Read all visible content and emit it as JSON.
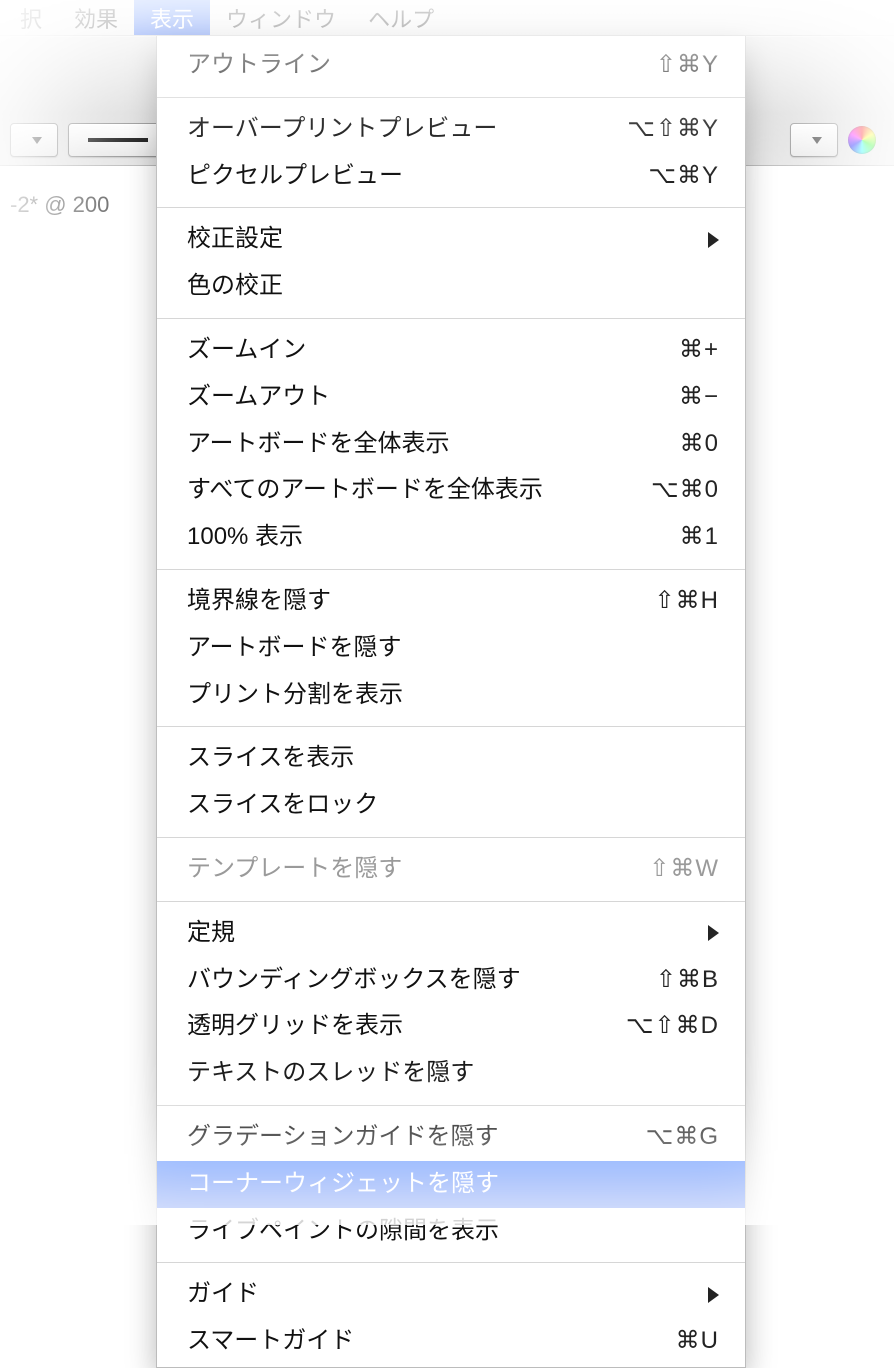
{
  "menubar": {
    "items": [
      {
        "label": "択"
      },
      {
        "label": "効果"
      },
      {
        "label": "表示",
        "active": true
      },
      {
        "label": "ウィンドウ"
      },
      {
        "label": "ヘルプ"
      }
    ]
  },
  "doc_tab": "-2* @ 200",
  "menu": {
    "groups": [
      [
        {
          "id": "outline",
          "label": "アウトライン",
          "shortcut": "⇧⌘Y"
        }
      ],
      [
        {
          "id": "overprint-preview",
          "label": "オーバープリントプレビュー",
          "shortcut": "⌥⇧⌘Y"
        },
        {
          "id": "pixel-preview",
          "label": "ピクセルプレビュー",
          "shortcut": "⌥⌘Y"
        }
      ],
      [
        {
          "id": "proof-setup",
          "label": "校正設定",
          "submenu": true
        },
        {
          "id": "proof-colors",
          "label": "色の校正"
        }
      ],
      [
        {
          "id": "zoom-in",
          "label": "ズームイン",
          "shortcut": "⌘+"
        },
        {
          "id": "zoom-out",
          "label": "ズームアウト",
          "shortcut": "⌘−"
        },
        {
          "id": "fit-artboard",
          "label": "アートボードを全体表示",
          "shortcut": "⌘0"
        },
        {
          "id": "fit-all-artboards",
          "label": "すべてのアートボードを全体表示",
          "shortcut": "⌥⌘0"
        },
        {
          "id": "actual-size",
          "label": "100% 表示",
          "shortcut": "⌘1"
        }
      ],
      [
        {
          "id": "hide-edges",
          "label": "境界線を隠す",
          "shortcut": "⇧⌘H"
        },
        {
          "id": "hide-artboards",
          "label": "アートボードを隠す"
        },
        {
          "id": "show-print-tiling",
          "label": "プリント分割を表示"
        }
      ],
      [
        {
          "id": "show-slices",
          "label": "スライスを表示"
        },
        {
          "id": "lock-slices",
          "label": "スライスをロック"
        }
      ],
      [
        {
          "id": "hide-template",
          "label": "テンプレートを隠す",
          "shortcut": "⇧⌘W",
          "disabled": true
        }
      ],
      [
        {
          "id": "rulers",
          "label": "定規",
          "submenu": true
        },
        {
          "id": "hide-bounding-box",
          "label": "バウンディングボックスを隠す",
          "shortcut": "⇧⌘B"
        },
        {
          "id": "show-transparency-grid",
          "label": "透明グリッドを表示",
          "shortcut": "⌥⇧⌘D"
        },
        {
          "id": "hide-text-threads",
          "label": "テキストのスレッドを隠す"
        }
      ],
      [
        {
          "id": "hide-gradient-annotator",
          "label": "グラデーションガイドを隠す",
          "shortcut": "⌥⌘G"
        },
        {
          "id": "hide-corner-widget",
          "label": "コーナーウィジェットを隠す",
          "highlight": true
        },
        {
          "id": "show-live-paint-gaps",
          "label": "ライブペイントの隙間を表示"
        }
      ],
      [
        {
          "id": "guides",
          "label": "ガイド",
          "submenu": true
        },
        {
          "id": "smart-guides",
          "label": "スマートガイド",
          "shortcut": "⌘U"
        }
      ]
    ]
  }
}
